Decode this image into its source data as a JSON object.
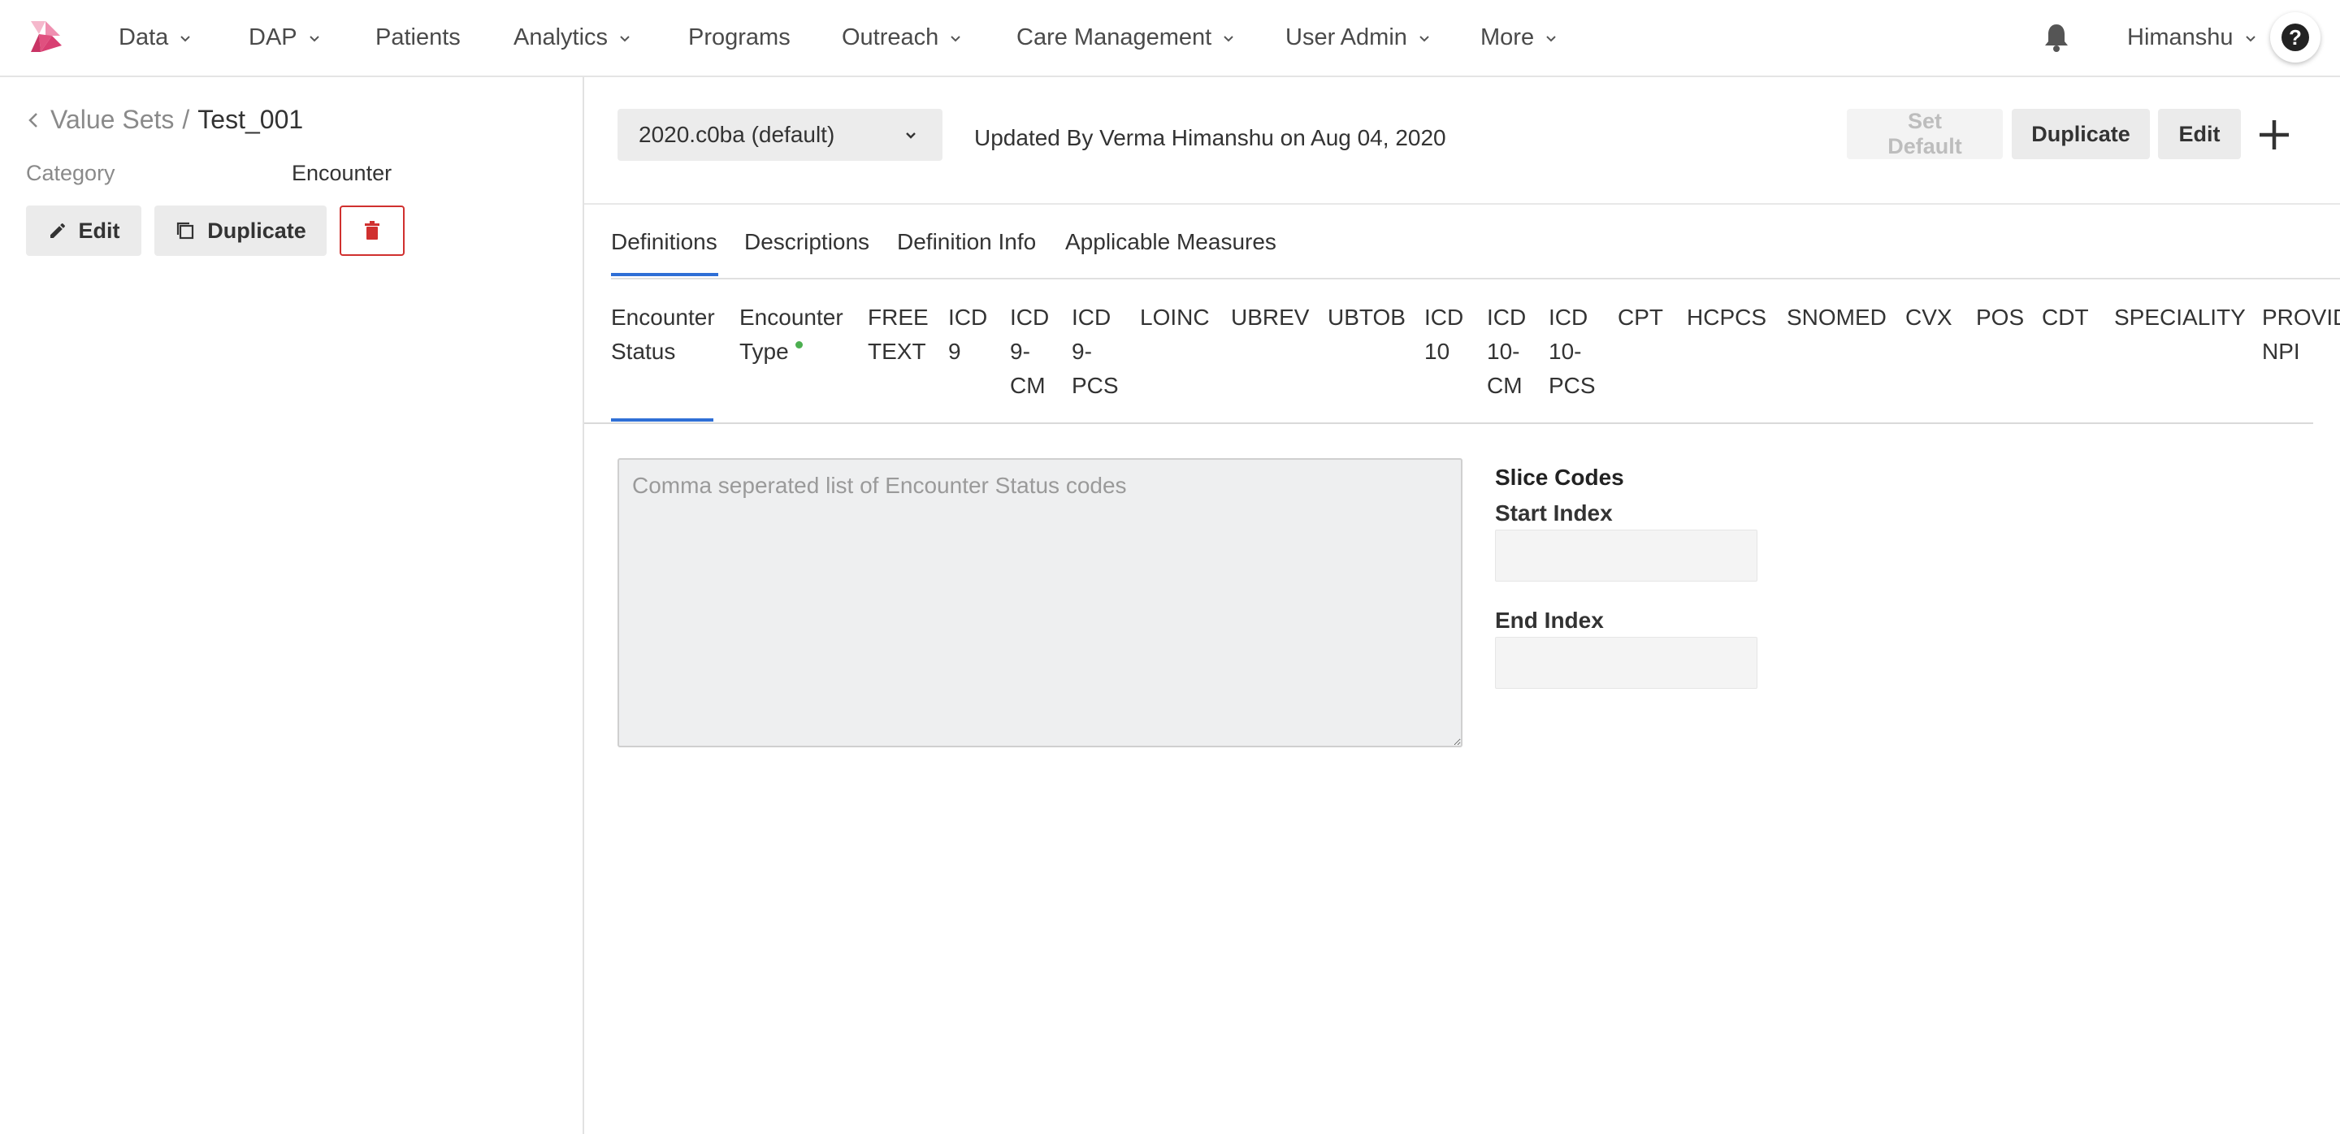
{
  "nav": {
    "items": [
      {
        "label": "Data",
        "dropdown": true
      },
      {
        "label": "DAP",
        "dropdown": true
      },
      {
        "label": "Patients",
        "dropdown": false
      },
      {
        "label": "Analytics",
        "dropdown": true
      },
      {
        "label": "Programs",
        "dropdown": false
      },
      {
        "label": "Outreach",
        "dropdown": true
      },
      {
        "label": "Care Management",
        "dropdown": true
      },
      {
        "label": "User Admin",
        "dropdown": true
      },
      {
        "label": "More",
        "dropdown": true
      }
    ],
    "user": "Himanshu",
    "help_glyph": "?"
  },
  "sidebar": {
    "breadcrumb_root": "Value Sets",
    "breadcrumb_sep": "/",
    "breadcrumb_current": "Test_001",
    "category_label": "Category",
    "category_value": "Encounter",
    "edit_label": "Edit",
    "duplicate_label": "Duplicate"
  },
  "toolbar": {
    "version": "2020.c0ba (default)",
    "updated_text": "Updated By Verma Himanshu on Aug 04, 2020",
    "set_default_label": "Set Default",
    "duplicate_label": "Duplicate",
    "edit_label": "Edit"
  },
  "tabs": [
    "Definitions",
    "Descriptions",
    "Definition Info",
    "Applicable Measures"
  ],
  "code_tabs": [
    {
      "label": "Encounter Status",
      "has_data": false
    },
    {
      "label": "Encounter Type",
      "has_data": true
    },
    {
      "label": "FREE TEXT",
      "has_data": false
    },
    {
      "label": "ICD 9",
      "has_data": false
    },
    {
      "label": "ICD 9-CM",
      "has_data": false
    },
    {
      "label": "ICD 9-PCS",
      "has_data": false
    },
    {
      "label": "LOINC",
      "has_data": false
    },
    {
      "label": "UBREV",
      "has_data": false
    },
    {
      "label": "UBTOB",
      "has_data": false
    },
    {
      "label": "ICD 10",
      "has_data": false
    },
    {
      "label": "ICD 10-CM",
      "has_data": false
    },
    {
      "label": "ICD 10-PCS",
      "has_data": false
    },
    {
      "label": "CPT",
      "has_data": false
    },
    {
      "label": "HCPCS",
      "has_data": false
    },
    {
      "label": "SNOMED",
      "has_data": false
    },
    {
      "label": "CVX",
      "has_data": false
    },
    {
      "label": "POS",
      "has_data": false
    },
    {
      "label": "CDT",
      "has_data": false
    },
    {
      "label": "SPECIALITY",
      "has_data": false
    },
    {
      "label": "PROVIDER NPI",
      "has_data": false
    }
  ],
  "codes_panel": {
    "codes_placeholder": "Comma seperated list of Encounter Status codes",
    "slice_title": "Slice Codes",
    "start_label": "Start Index",
    "end_label": "End Index",
    "start_value": "",
    "end_value": ""
  },
  "colors": {
    "accent": "#2f6fd6",
    "danger": "#d0302f",
    "status_dot": "#4caf50"
  }
}
